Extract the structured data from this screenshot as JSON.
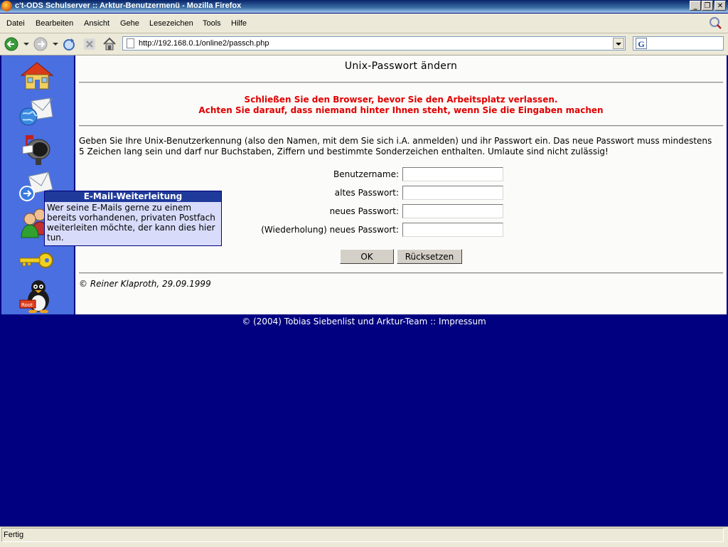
{
  "window": {
    "title": "c't-ODS Schulserver :: Arktur-Benutzermenü - Mozilla Firefox",
    "min_label": "_",
    "max_label": "❐",
    "close_label": "✕"
  },
  "menu": {
    "items": [
      "Datei",
      "Bearbeiten",
      "Ansicht",
      "Gehe",
      "Lesezeichen",
      "Tools",
      "Hilfe"
    ]
  },
  "toolbar": {
    "url": "http://192.168.0.1/online2/passch.php",
    "search_engine_letter": "G"
  },
  "sidebar": {
    "items": [
      {
        "icon": "home-icon"
      },
      {
        "icon": "globe-mail-icon"
      },
      {
        "icon": "mailbox-icon"
      },
      {
        "icon": "mail-forward-icon"
      },
      {
        "icon": "users-icon"
      },
      {
        "icon": "key-icon"
      },
      {
        "icon": "tux-root-icon",
        "badge": "Root"
      }
    ]
  },
  "tooltip": {
    "title": "E-Mail-Weiterleitung",
    "text": "Wer seine E-Mails gerne zu einem bereits vorhandenen, privaten Postfach weiterleiten möchte, der kann dies hier tun."
  },
  "content": {
    "heading": "Unix-Passwort ändern",
    "warning_1": "Schließen Sie den Browser, bevor Sie den Arbeitsplatz verlassen.",
    "warning_2": "Achten Sie darauf, dass niemand hinter Ihnen steht, wenn Sie die Eingaben machen",
    "intro": "Geben Sie Ihre Unix-Benutzerkennung (also den Namen, mit dem Sie sich i.A. anmelden) und ihr Passwort ein. Das neue Passwort muss mindestens 5 Zeichen lang sein und darf nur Buchstaben, Ziffern und bestimmte Sonderzeichen enthalten. Umlaute sind nicht zulässig!",
    "fields": [
      {
        "label": "Benutzername:",
        "value": ""
      },
      {
        "label": "altes Passwort:",
        "value": ""
      },
      {
        "label": "neues Passwort:",
        "value": ""
      },
      {
        "label": "(Wiederholung) neues Passwort:",
        "value": ""
      }
    ],
    "ok_label": "OK",
    "reset_label": "Rücksetzen",
    "author_note": "© Reiner Klaproth, 29.09.1999"
  },
  "page_footer": "© (2004) Tobias Siebenlist und Arktur-Team :: Impressum",
  "status": {
    "text": "Fertig"
  },
  "colors": {
    "page_bg": "#000080",
    "sidebar_bg": "#4a6fe0",
    "warning": "#e00000",
    "tooltip_bg": "#d8dcfa",
    "tooltip_head": "#1f3a9a"
  }
}
